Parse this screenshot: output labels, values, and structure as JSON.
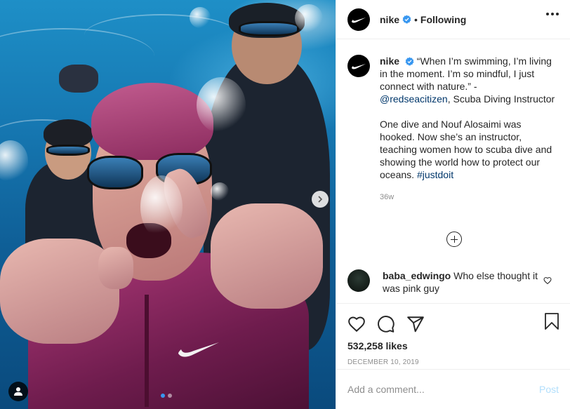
{
  "post": {
    "author": "nike",
    "separator": "•",
    "follow_label": "Following",
    "caption_quote": "“When I’m swimming, I’m living in the moment. I’m so mindful, I just connect with nature.” -",
    "caption_mention": "@redseacitizen",
    "caption_role": ", Scuba Diving Instructor",
    "caption_body": "One dive and Nouf Alosaimi was hooked. Now she’s an instructor, teaching women how to scuba dive and showing the world how to protect our oceans.",
    "caption_hashtag": "#justdoit",
    "caption_time": "36w",
    "likes": "532,258 likes",
    "date": "DECEMBER 10, 2019"
  },
  "comment": {
    "user": "baba_edwingo",
    "text": "Who else thought it was pink guy"
  },
  "compose": {
    "placeholder": "Add a comment...",
    "post_label": "Post"
  },
  "carousel": {
    "slides": 2,
    "current": 1
  },
  "colors": {
    "verified": "#3897f0",
    "link": "#00376b",
    "post_disabled": "#b2dffc"
  },
  "icons": [
    "nike-swoosh-icon",
    "verified-badge-icon",
    "more-options-icon",
    "load-more-comments-icon",
    "heart-icon",
    "comment-icon",
    "share-icon",
    "bookmark-icon",
    "next-slide-icon",
    "user-tag-icon"
  ]
}
